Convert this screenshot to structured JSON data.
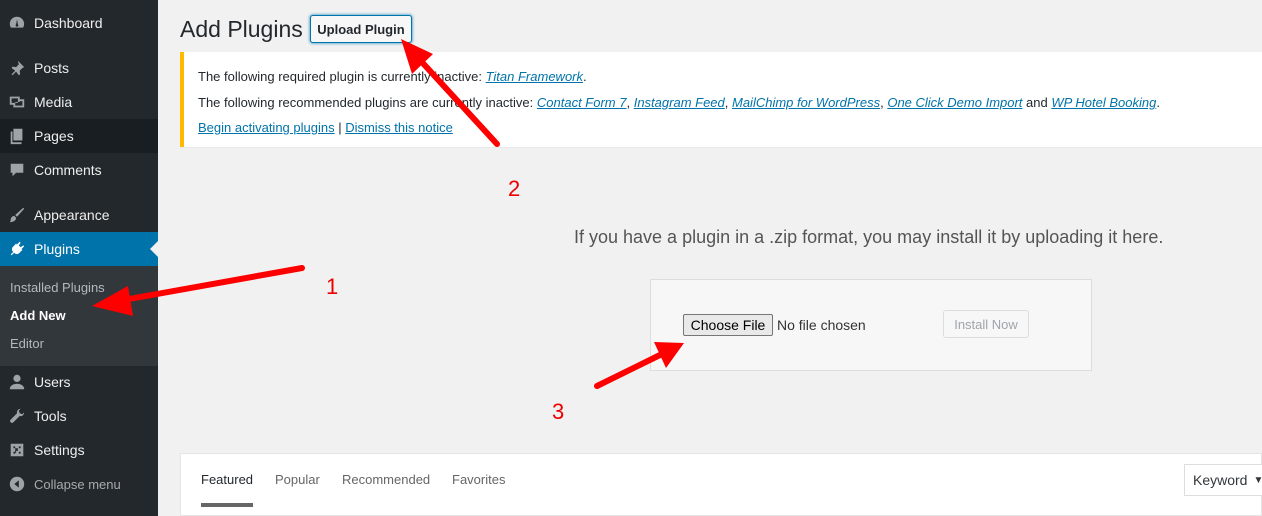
{
  "sidebar": {
    "items": [
      {
        "label": "Dashboard",
        "icon": "dashboard-icon"
      },
      {
        "label": "Posts",
        "icon": "pin-icon"
      },
      {
        "label": "Media",
        "icon": "media-icon"
      },
      {
        "label": "Pages",
        "icon": "pages-icon"
      },
      {
        "label": "Comments",
        "icon": "comment-icon"
      },
      {
        "label": "Appearance",
        "icon": "brush-icon"
      },
      {
        "label": "Plugins",
        "icon": "plug-icon"
      },
      {
        "label": "Users",
        "icon": "user-icon"
      },
      {
        "label": "Tools",
        "icon": "wrench-icon"
      },
      {
        "label": "Settings",
        "icon": "settings-icon"
      },
      {
        "label": "Collapse menu",
        "icon": "collapse-icon"
      }
    ],
    "submenu": [
      "Installed Plugins",
      "Add New",
      "Editor"
    ]
  },
  "header": {
    "title": "Add Plugins",
    "upload_label": "Upload Plugin"
  },
  "notice": {
    "required_text": "The following required plugin is currently inactive: ",
    "required_plugin": "Titan Framework",
    "recommended_text": "The following recommended plugins are currently inactive: ",
    "recommended_plugins": [
      "Contact Form 7",
      "Instagram Feed",
      "MailChimp for WordPress",
      "One Click Demo Import",
      "WP Hotel Booking"
    ],
    "and": " and ",
    "begin_link": "Begin activating plugins",
    "separator": " | ",
    "dismiss_link": "Dismiss this notice"
  },
  "upload": {
    "instructions": "If you have a plugin in a .zip format, you may install it by uploading it here.",
    "choose_label": "Choose File",
    "no_file": "No file chosen",
    "install_label": "Install Now"
  },
  "filter": {
    "tabs": [
      "Featured",
      "Popular",
      "Recommended",
      "Favorites"
    ],
    "search_type": "Keyword"
  },
  "annotations": {
    "numbers": [
      "1",
      "2",
      "3"
    ],
    "color": "#ff0000"
  }
}
